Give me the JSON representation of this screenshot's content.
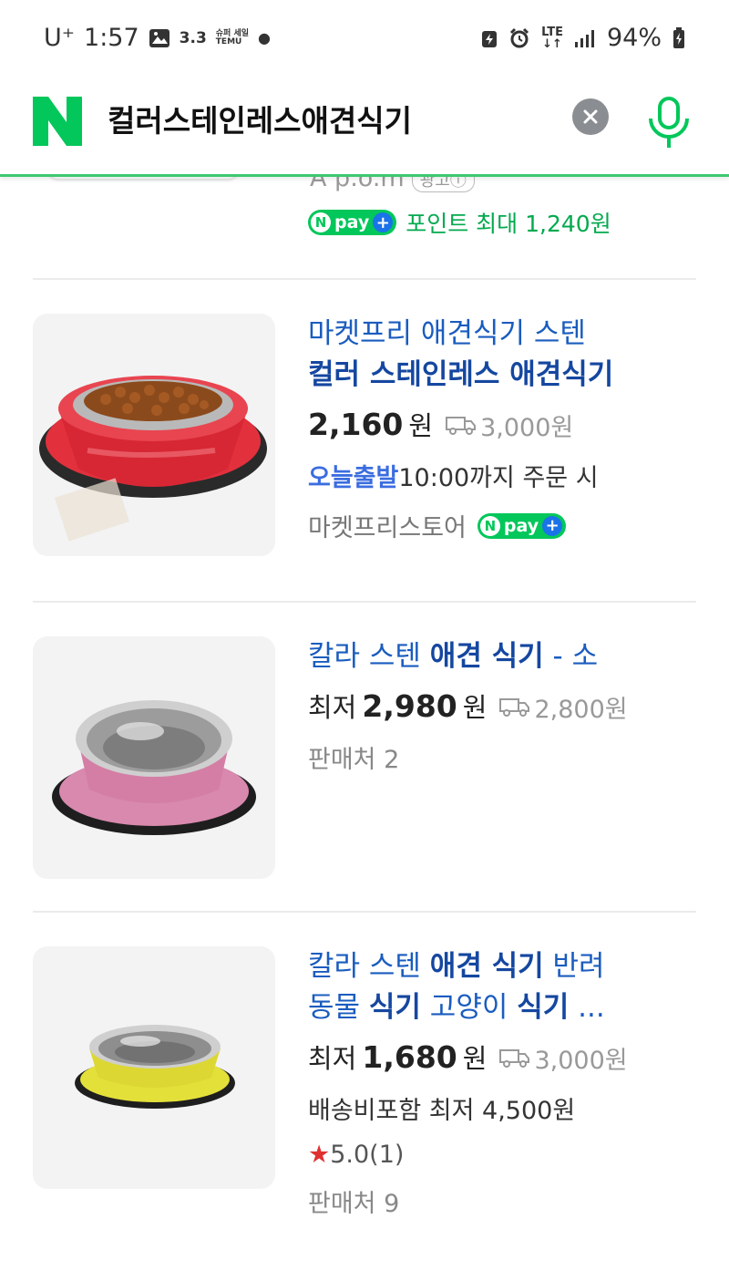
{
  "status_bar": {
    "carrier": "U⁺",
    "time": "1:57",
    "notif_small": "3.3",
    "notif_tiny_top": "슈퍼 세일",
    "notif_tiny_bottom": "TEMU",
    "network": "LTE",
    "battery": "94%"
  },
  "search": {
    "query": "컬러스테인레스애견식기",
    "logo_letter": "N"
  },
  "partial_item": {
    "brand": "A p.o.m",
    "ad_label": "광고ⓘ",
    "npay_label": "pay",
    "point_text": "포인트 최대 1,240원"
  },
  "items": [
    {
      "title_line1": "마켓프리 애견식기 스텐",
      "title_line2": "컬러 스테인레스 애견식기",
      "price": "2,160",
      "currency": "원",
      "shipping": "3,000원",
      "today_label": "오늘출발",
      "today_detail": "10:00까지 주문 시",
      "store": "마켓프리스토어",
      "npay_label": "pay"
    },
    {
      "title_a": "칼라 스텐 ",
      "title_b": "애견 식기",
      "title_c": " - 소",
      "price_prefix": "최저",
      "price": "2,980",
      "currency": "원",
      "shipping": "2,800원",
      "sellers": "판매처 2"
    },
    {
      "title_a": "칼라 스텐 ",
      "title_b": "애견 식기",
      "title_c": " 반려",
      "title_d": "동물 ",
      "title_e": "식기",
      "title_f": " 고양이 ",
      "title_g": "식기",
      "title_h": " ...",
      "price_prefix": "최저",
      "price": "1,680",
      "currency": "원",
      "shipping": "3,000원",
      "shipping_incl": "배송비포함 최저 4,500원",
      "rating_star": "★",
      "rating": "5.0",
      "rating_count": "(1)",
      "sellers": "판매처 9"
    }
  ],
  "colors": {
    "naver_green": "#03c75a",
    "link_blue": "#1a5cbf",
    "bowl_red": "#e0303c",
    "bowl_pink": "#d98aac",
    "bowl_yellow": "#e5e03a"
  }
}
